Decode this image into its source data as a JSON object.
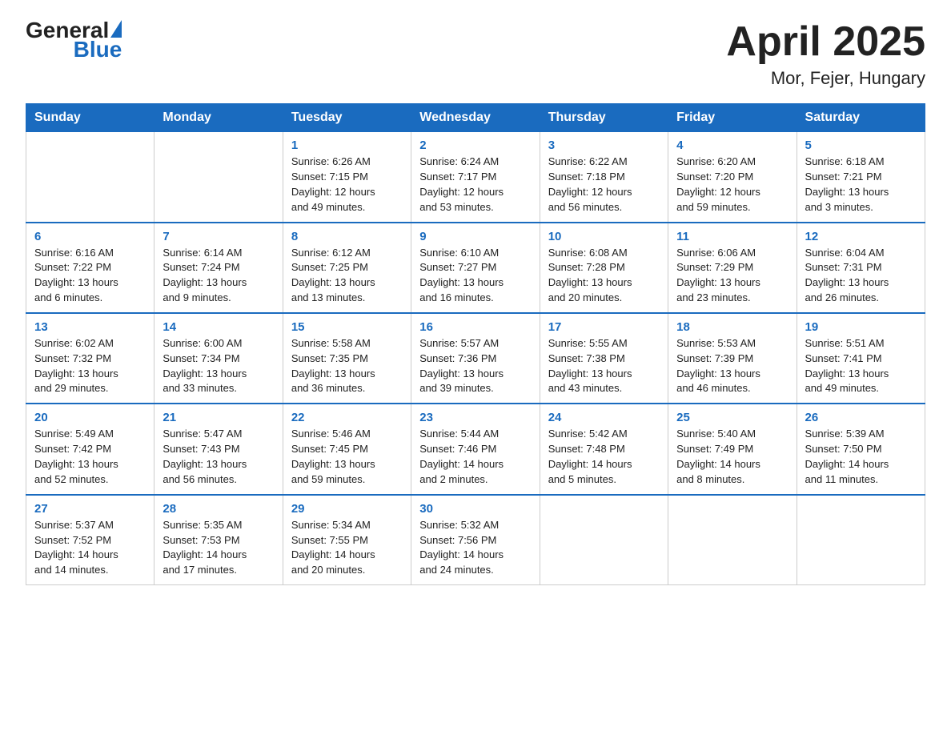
{
  "header": {
    "logo_general": "General",
    "logo_blue": "Blue",
    "month_year": "April 2025",
    "location": "Mor, Fejer, Hungary"
  },
  "weekdays": [
    "Sunday",
    "Monday",
    "Tuesday",
    "Wednesday",
    "Thursday",
    "Friday",
    "Saturday"
  ],
  "weeks": [
    [
      {
        "day": "",
        "sunrise": "",
        "sunset": "",
        "daylight": ""
      },
      {
        "day": "",
        "sunrise": "",
        "sunset": "",
        "daylight": ""
      },
      {
        "day": "1",
        "sunrise": "Sunrise: 6:26 AM",
        "sunset": "Sunset: 7:15 PM",
        "daylight": "Daylight: 12 hours and 49 minutes."
      },
      {
        "day": "2",
        "sunrise": "Sunrise: 6:24 AM",
        "sunset": "Sunset: 7:17 PM",
        "daylight": "Daylight: 12 hours and 53 minutes."
      },
      {
        "day": "3",
        "sunrise": "Sunrise: 6:22 AM",
        "sunset": "Sunset: 7:18 PM",
        "daylight": "Daylight: 12 hours and 56 minutes."
      },
      {
        "day": "4",
        "sunrise": "Sunrise: 6:20 AM",
        "sunset": "Sunset: 7:20 PM",
        "daylight": "Daylight: 12 hours and 59 minutes."
      },
      {
        "day": "5",
        "sunrise": "Sunrise: 6:18 AM",
        "sunset": "Sunset: 7:21 PM",
        "daylight": "Daylight: 13 hours and 3 minutes."
      }
    ],
    [
      {
        "day": "6",
        "sunrise": "Sunrise: 6:16 AM",
        "sunset": "Sunset: 7:22 PM",
        "daylight": "Daylight: 13 hours and 6 minutes."
      },
      {
        "day": "7",
        "sunrise": "Sunrise: 6:14 AM",
        "sunset": "Sunset: 7:24 PM",
        "daylight": "Daylight: 13 hours and 9 minutes."
      },
      {
        "day": "8",
        "sunrise": "Sunrise: 6:12 AM",
        "sunset": "Sunset: 7:25 PM",
        "daylight": "Daylight: 13 hours and 13 minutes."
      },
      {
        "day": "9",
        "sunrise": "Sunrise: 6:10 AM",
        "sunset": "Sunset: 7:27 PM",
        "daylight": "Daylight: 13 hours and 16 minutes."
      },
      {
        "day": "10",
        "sunrise": "Sunrise: 6:08 AM",
        "sunset": "Sunset: 7:28 PM",
        "daylight": "Daylight: 13 hours and 20 minutes."
      },
      {
        "day": "11",
        "sunrise": "Sunrise: 6:06 AM",
        "sunset": "Sunset: 7:29 PM",
        "daylight": "Daylight: 13 hours and 23 minutes."
      },
      {
        "day": "12",
        "sunrise": "Sunrise: 6:04 AM",
        "sunset": "Sunset: 7:31 PM",
        "daylight": "Daylight: 13 hours and 26 minutes."
      }
    ],
    [
      {
        "day": "13",
        "sunrise": "Sunrise: 6:02 AM",
        "sunset": "Sunset: 7:32 PM",
        "daylight": "Daylight: 13 hours and 29 minutes."
      },
      {
        "day": "14",
        "sunrise": "Sunrise: 6:00 AM",
        "sunset": "Sunset: 7:34 PM",
        "daylight": "Daylight: 13 hours and 33 minutes."
      },
      {
        "day": "15",
        "sunrise": "Sunrise: 5:58 AM",
        "sunset": "Sunset: 7:35 PM",
        "daylight": "Daylight: 13 hours and 36 minutes."
      },
      {
        "day": "16",
        "sunrise": "Sunrise: 5:57 AM",
        "sunset": "Sunset: 7:36 PM",
        "daylight": "Daylight: 13 hours and 39 minutes."
      },
      {
        "day": "17",
        "sunrise": "Sunrise: 5:55 AM",
        "sunset": "Sunset: 7:38 PM",
        "daylight": "Daylight: 13 hours and 43 minutes."
      },
      {
        "day": "18",
        "sunrise": "Sunrise: 5:53 AM",
        "sunset": "Sunset: 7:39 PM",
        "daylight": "Daylight: 13 hours and 46 minutes."
      },
      {
        "day": "19",
        "sunrise": "Sunrise: 5:51 AM",
        "sunset": "Sunset: 7:41 PM",
        "daylight": "Daylight: 13 hours and 49 minutes."
      }
    ],
    [
      {
        "day": "20",
        "sunrise": "Sunrise: 5:49 AM",
        "sunset": "Sunset: 7:42 PM",
        "daylight": "Daylight: 13 hours and 52 minutes."
      },
      {
        "day": "21",
        "sunrise": "Sunrise: 5:47 AM",
        "sunset": "Sunset: 7:43 PM",
        "daylight": "Daylight: 13 hours and 56 minutes."
      },
      {
        "day": "22",
        "sunrise": "Sunrise: 5:46 AM",
        "sunset": "Sunset: 7:45 PM",
        "daylight": "Daylight: 13 hours and 59 minutes."
      },
      {
        "day": "23",
        "sunrise": "Sunrise: 5:44 AM",
        "sunset": "Sunset: 7:46 PM",
        "daylight": "Daylight: 14 hours and 2 minutes."
      },
      {
        "day": "24",
        "sunrise": "Sunrise: 5:42 AM",
        "sunset": "Sunset: 7:48 PM",
        "daylight": "Daylight: 14 hours and 5 minutes."
      },
      {
        "day": "25",
        "sunrise": "Sunrise: 5:40 AM",
        "sunset": "Sunset: 7:49 PM",
        "daylight": "Daylight: 14 hours and 8 minutes."
      },
      {
        "day": "26",
        "sunrise": "Sunrise: 5:39 AM",
        "sunset": "Sunset: 7:50 PM",
        "daylight": "Daylight: 14 hours and 11 minutes."
      }
    ],
    [
      {
        "day": "27",
        "sunrise": "Sunrise: 5:37 AM",
        "sunset": "Sunset: 7:52 PM",
        "daylight": "Daylight: 14 hours and 14 minutes."
      },
      {
        "day": "28",
        "sunrise": "Sunrise: 5:35 AM",
        "sunset": "Sunset: 7:53 PM",
        "daylight": "Daylight: 14 hours and 17 minutes."
      },
      {
        "day": "29",
        "sunrise": "Sunrise: 5:34 AM",
        "sunset": "Sunset: 7:55 PM",
        "daylight": "Daylight: 14 hours and 20 minutes."
      },
      {
        "day": "30",
        "sunrise": "Sunrise: 5:32 AM",
        "sunset": "Sunset: 7:56 PM",
        "daylight": "Daylight: 14 hours and 24 minutes."
      },
      {
        "day": "",
        "sunrise": "",
        "sunset": "",
        "daylight": ""
      },
      {
        "day": "",
        "sunrise": "",
        "sunset": "",
        "daylight": ""
      },
      {
        "day": "",
        "sunrise": "",
        "sunset": "",
        "daylight": ""
      }
    ]
  ]
}
